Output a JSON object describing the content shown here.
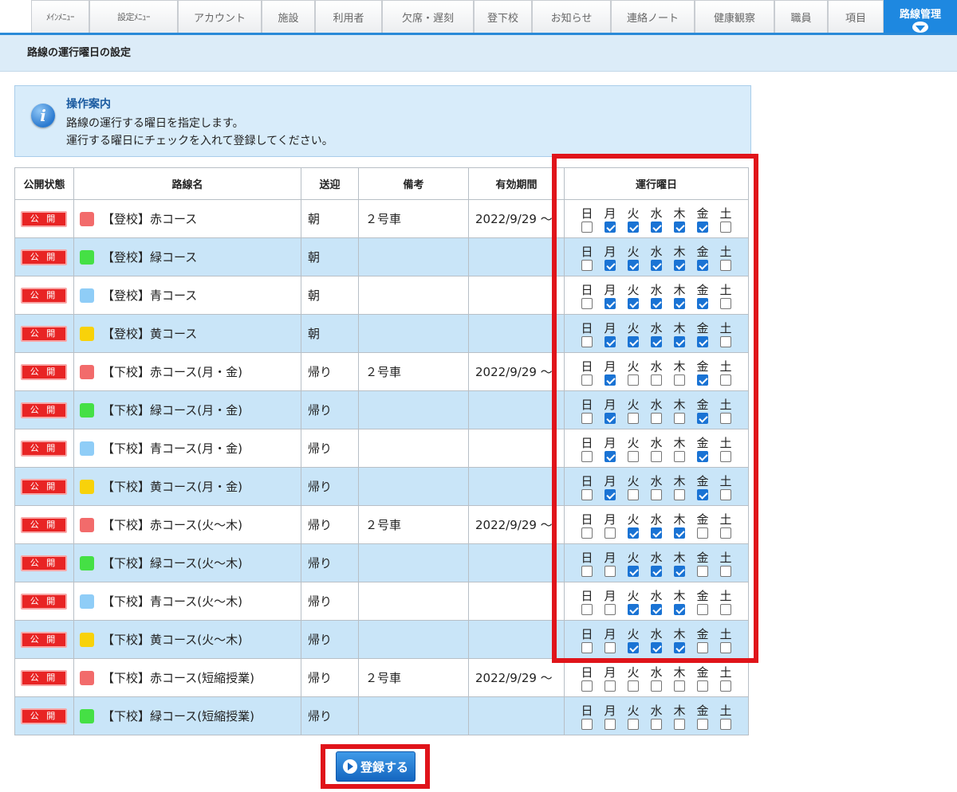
{
  "nav": {
    "tabs": [
      {
        "label": "ﾒｲﾝﾒﾆｭｰ",
        "small": true
      },
      {
        "label": "設定ﾒﾆｭｰ",
        "small": true
      },
      {
        "label": "アカウント"
      },
      {
        "label": "施設"
      },
      {
        "label": "利用者"
      },
      {
        "label": "欠席・遅刻"
      },
      {
        "label": "登下校"
      },
      {
        "label": "お知らせ"
      },
      {
        "label": "連絡ノート"
      },
      {
        "label": "健康観察"
      },
      {
        "label": "職員"
      },
      {
        "label": "項目"
      },
      {
        "label": "路線管理",
        "active": true
      }
    ]
  },
  "page_title": "路線の運行曜日の設定",
  "info": {
    "icon": "info-icon",
    "title": "操作案内",
    "lines": [
      "路線の運行する曜日を指定します。",
      "運行する曜日にチェックを入れて登録してください。"
    ]
  },
  "table": {
    "headers": {
      "status": "公開状態",
      "name": "路線名",
      "pickup": "送迎",
      "note": "備考",
      "period": "有効期間",
      "days": "運行曜日"
    },
    "day_labels": [
      "日",
      "月",
      "火",
      "水",
      "木",
      "金",
      "土"
    ],
    "status_label": "公 開",
    "colors": {
      "red": "#f26b6b",
      "green": "#45e045",
      "blue": "#8fcdf7",
      "yellow": "#f8d20a"
    },
    "rows": [
      {
        "color": "red",
        "name": "【登校】赤コース",
        "pickup": "朝",
        "note": "２号車",
        "period": "2022/9/29 ～",
        "days": [
          false,
          true,
          true,
          true,
          true,
          true,
          false
        ]
      },
      {
        "color": "green",
        "name": "【登校】緑コース",
        "pickup": "朝",
        "note": "",
        "period": "",
        "days": [
          false,
          true,
          true,
          true,
          true,
          true,
          false
        ]
      },
      {
        "color": "blue",
        "name": "【登校】青コース",
        "pickup": "朝",
        "note": "",
        "period": "",
        "days": [
          false,
          true,
          true,
          true,
          true,
          true,
          false
        ]
      },
      {
        "color": "yellow",
        "name": "【登校】黄コース",
        "pickup": "朝",
        "note": "",
        "period": "",
        "days": [
          false,
          true,
          true,
          true,
          true,
          true,
          false
        ]
      },
      {
        "color": "red",
        "name": "【下校】赤コース(月・金)",
        "pickup": "帰り",
        "note": "２号車",
        "period": "2022/9/29 ～",
        "days": [
          false,
          true,
          false,
          false,
          false,
          true,
          false
        ]
      },
      {
        "color": "green",
        "name": "【下校】緑コース(月・金)",
        "pickup": "帰り",
        "note": "",
        "period": "",
        "days": [
          false,
          true,
          false,
          false,
          false,
          true,
          false
        ]
      },
      {
        "color": "blue",
        "name": "【下校】青コース(月・金)",
        "pickup": "帰り",
        "note": "",
        "period": "",
        "days": [
          false,
          true,
          false,
          false,
          false,
          true,
          false
        ]
      },
      {
        "color": "yellow",
        "name": "【下校】黄コース(月・金)",
        "pickup": "帰り",
        "note": "",
        "period": "",
        "days": [
          false,
          true,
          false,
          false,
          false,
          true,
          false
        ]
      },
      {
        "color": "red",
        "name": "【下校】赤コース(火～木)",
        "pickup": "帰り",
        "note": "２号車",
        "period": "2022/9/29 ～",
        "days": [
          false,
          false,
          true,
          true,
          true,
          false,
          false
        ]
      },
      {
        "color": "green",
        "name": "【下校】緑コース(火～木)",
        "pickup": "帰り",
        "note": "",
        "period": "",
        "days": [
          false,
          false,
          true,
          true,
          true,
          false,
          false
        ]
      },
      {
        "color": "blue",
        "name": "【下校】青コース(火～木)",
        "pickup": "帰り",
        "note": "",
        "period": "",
        "days": [
          false,
          false,
          true,
          true,
          true,
          false,
          false
        ]
      },
      {
        "color": "yellow",
        "name": "【下校】黄コース(火～木)",
        "pickup": "帰り",
        "note": "",
        "period": "",
        "days": [
          false,
          false,
          true,
          true,
          true,
          false,
          false
        ]
      },
      {
        "color": "red",
        "name": "【下校】赤コース(短縮授業)",
        "pickup": "帰り",
        "note": "２号車",
        "period": "2022/9/29 ～",
        "days": [
          false,
          false,
          false,
          false,
          false,
          false,
          false
        ]
      },
      {
        "color": "green",
        "name": "【下校】緑コース(短縮授業)",
        "pickup": "帰り",
        "note": "",
        "period": "",
        "days": [
          false,
          false,
          false,
          false,
          false,
          false,
          false
        ]
      }
    ]
  },
  "submit": {
    "label": "登録する",
    "icon": "play-circle-icon"
  },
  "highlight_color": "#e0141a"
}
